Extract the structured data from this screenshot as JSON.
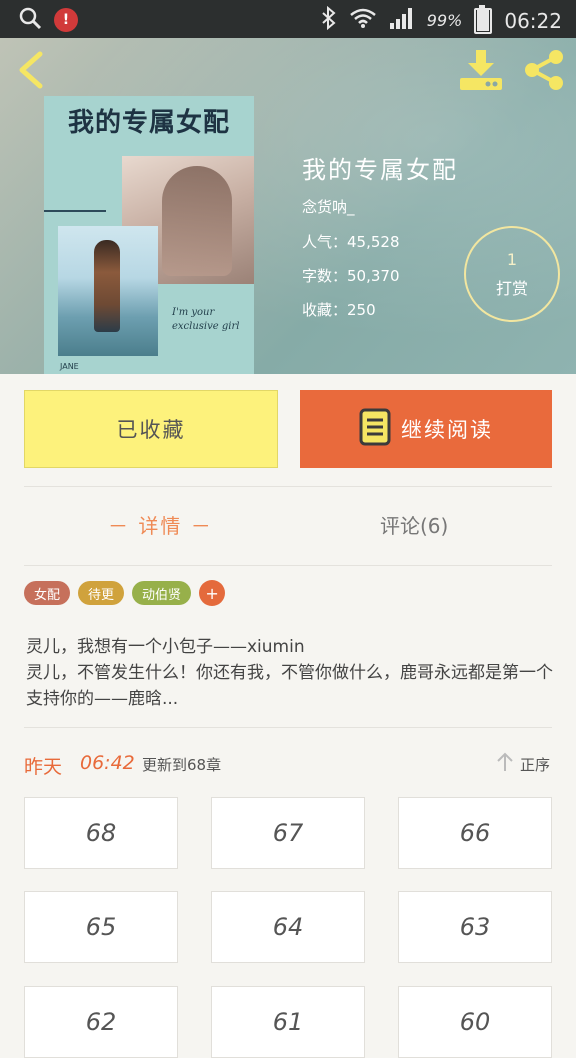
{
  "status_bar": {
    "battery": "99%",
    "time": "06:22",
    "battery_level": 0.99
  },
  "book": {
    "cover_title": "我的专属女配",
    "cover_caption": "I'm your exclusive girl",
    "cover_author": "JANE",
    "title": "我的专属女配",
    "author": "念货呐_",
    "popularity": "人气：45,528",
    "word_count": "字数：50,370",
    "favorites": "收藏：250"
  },
  "tip": {
    "count": "1",
    "label": "打赏"
  },
  "actions": {
    "favorited_label": "已收藏",
    "continue_label": "继续阅读"
  },
  "tabs": {
    "detail": "－ 详情 －",
    "comments": "评论(6)"
  },
  "tags": [
    {
      "label": "女配",
      "color": "#c6705b"
    },
    {
      "label": "待更",
      "color": "#d0a23c"
    },
    {
      "label": "动伯贤",
      "color": "#97b04a"
    }
  ],
  "tag_add": "+",
  "description": {
    "line1": "灵儿，我想有一个小包子——xiumin",
    "line2": "灵儿，不管发生什么！你还有我，不管你做什么，鹿哥永远都是第一个支持你的——鹿晗..."
  },
  "update": {
    "day": "昨天",
    "time": "06:42",
    "text": "更新到68章",
    "sort_label": "正序"
  },
  "chapters": [
    "68",
    "67",
    "66",
    "65",
    "64",
    "63",
    "62",
    "61",
    "60"
  ],
  "colors": {
    "accent": "#e96a3c",
    "favorite_button": "#fdf27c",
    "icon_yellow": "#f5e663"
  }
}
